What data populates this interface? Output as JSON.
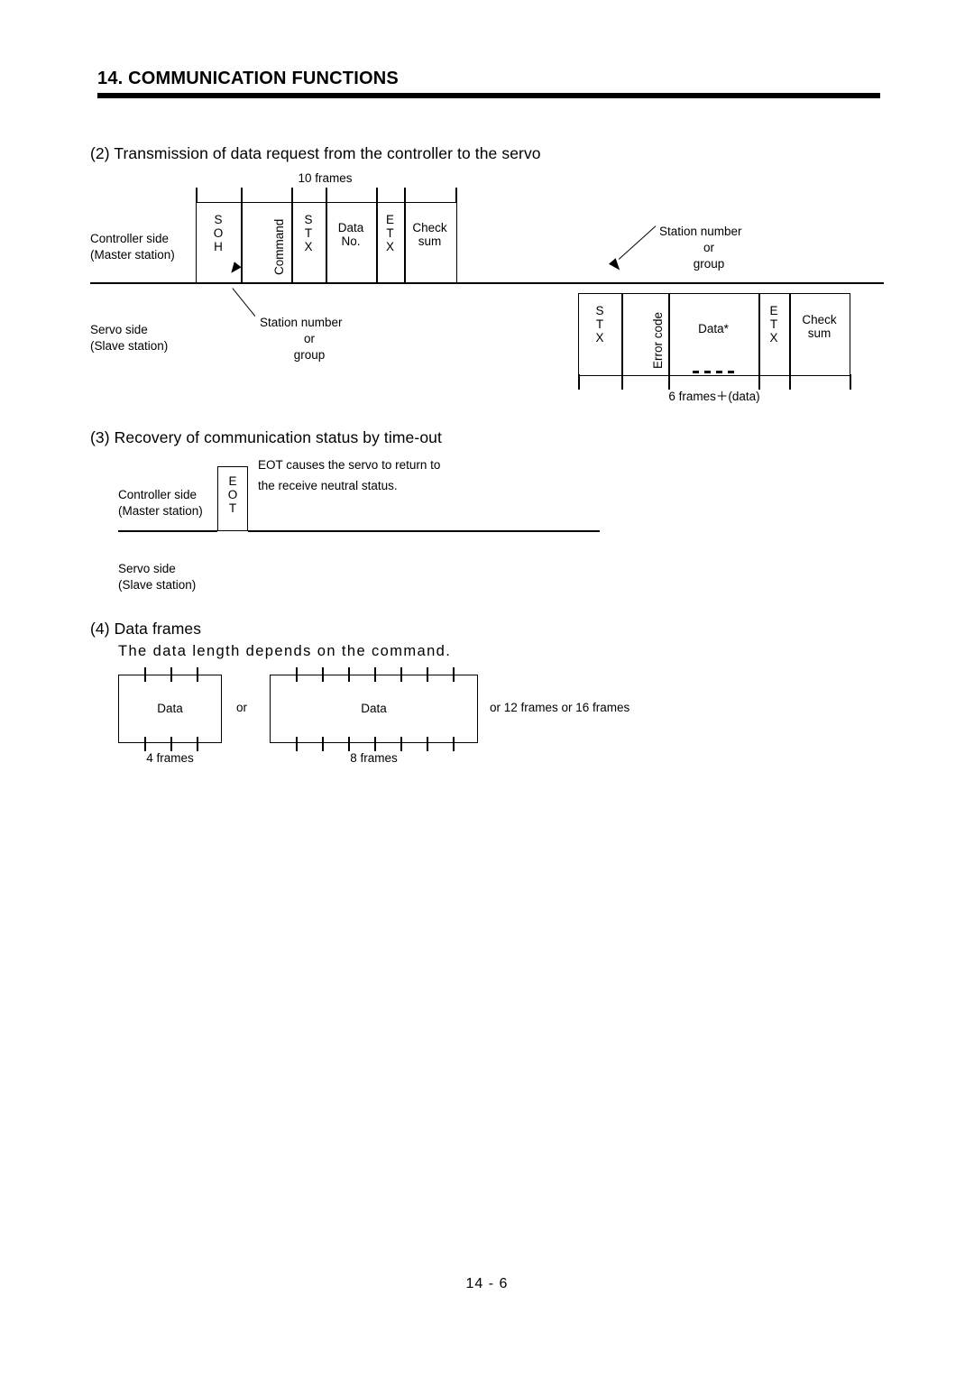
{
  "header": {
    "chapter_title": "14. COMMUNICATION FUNCTIONS"
  },
  "sections": {
    "s2": {
      "heading": "(2) Transmission of data request from the controller to the servo",
      "frames_label_top": "10 frames",
      "controller_side_line1": "Controller side",
      "controller_side_line2": "(Master station)",
      "servo_side_line1": "Servo side",
      "servo_side_line2": "(Slave station)",
      "master_cells": {
        "soh": "S\nO\nH",
        "command": "Command",
        "stx": "S\nT\nX",
        "data_no": "Data\nNo.",
        "etx": "E\nT\nX",
        "checksum": "Check\nsum"
      },
      "slave_cells": {
        "stx": "S\nT\nX",
        "error_code": "Error code",
        "data": "Data*",
        "etx": "E\nT\nX",
        "checksum": "Check\nsum"
      },
      "callout_left": {
        "l1": "Station number",
        "l2": "or",
        "l3": "group"
      },
      "callout_right": {
        "l1": "Station number",
        "l2": "or",
        "l3": "group"
      },
      "frames_label_bottom": "6 frames＋(data)"
    },
    "s3": {
      "heading": "(3) Recovery of communication status by time-out",
      "controller_side_line1": "Controller side",
      "controller_side_line2": "(Master station)",
      "servo_side_line1": "Servo side",
      "servo_side_line2": "(Slave station)",
      "eot": "E\nO\nT",
      "note_line1": "EOT causes the servo to return to",
      "note_line2": "the receive neutral status."
    },
    "s4": {
      "heading": "(4) Data frames",
      "subtitle": "The data length depends on the command.",
      "box1_label": "Data",
      "box1_caption": "4 frames",
      "or_label": "or",
      "box2_label": "Data",
      "box2_caption": "8 frames",
      "trailing_note": "or 12 frames or 16 frames"
    }
  },
  "footer": {
    "page_number": "14 -  6"
  }
}
